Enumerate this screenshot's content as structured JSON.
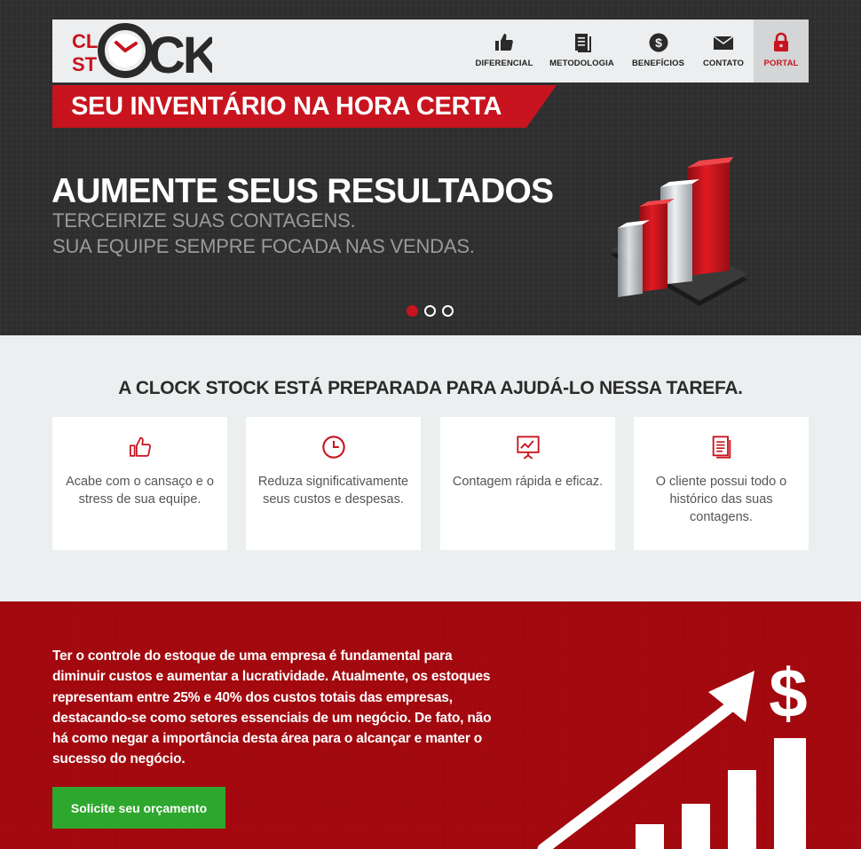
{
  "brand": {
    "logo_small_top": "CL",
    "logo_small_bottom": "ST",
    "logo_big": "CK",
    "tagline": "SEU INVENTÁRIO NA HORA CERTA"
  },
  "nav": {
    "items": [
      {
        "label": "DIFERENCIAL",
        "icon": "thumbs-up-icon"
      },
      {
        "label": "METODOLOGIA",
        "icon": "document-icon"
      },
      {
        "label": "BENEFÍCIOS",
        "icon": "dollar-icon"
      },
      {
        "label": "CONTATO",
        "icon": "envelope-icon"
      },
      {
        "label": "PORTAL",
        "icon": "lock-icon"
      }
    ]
  },
  "hero": {
    "title": "AUMENTE SEUS RESULTADOS",
    "subtitle_line1": "TERCEIRIZE SUAS CONTAGENS.",
    "subtitle_line2": "SUA EQUIPE SEMPRE FOCADA NAS VENDAS.",
    "slides_total": 3,
    "active_slide": 1
  },
  "features": {
    "title": "A CLOCK STOCK ESTÁ PREPARADA PARA AJUDÁ-LO NESSA TAREFA.",
    "cards": [
      {
        "icon": "thumbs-up-icon",
        "text": "Acabe com o cansaço e o stress de sua equipe."
      },
      {
        "icon": "clock-icon",
        "text": "Reduza significativamente seus custos e despesas."
      },
      {
        "icon": "presentation-chart-icon",
        "text": "Contagem rápida e eficaz."
      },
      {
        "icon": "document-icon",
        "text": "O cliente possui todo o histórico das suas contagens."
      }
    ]
  },
  "cta": {
    "text": "Ter o controle do estoque de uma empresa é fundamental para diminuir custos e aumentar a lucratividade. Atualmente, os estoques representam entre 25% e 40% dos custos totais das empresas, destacando-se como setores essenciais de um negócio. De fato, não há como negar a importância desta área para o alcançar e manter o sucesso do negócio.",
    "button": "Solicite seu orçamento",
    "graphic_symbol": "$"
  },
  "colors": {
    "brand_red": "#c8141e",
    "dark_bg": "#2f2e2f",
    "cta_red": "#a4090f",
    "button_green": "#2ea72e"
  }
}
